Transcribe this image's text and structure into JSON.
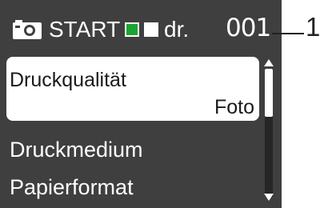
{
  "header": {
    "camera_icon": "camera-icon",
    "start_label": "START",
    "color_start_color": "#1aa531",
    "mono_start_color": "#ffffff",
    "copies_unit": "dr.",
    "copies_count": "001"
  },
  "menu": {
    "items": [
      {
        "label": "Druckqualität",
        "value": "Foto"
      },
      {
        "label": "Druckmedium"
      },
      {
        "label": "Papierformat"
      }
    ]
  },
  "scrollbar": {
    "up_icon": "scroll-up-arrow-icon",
    "down_icon": "scroll-down-arrow-icon"
  },
  "callout": {
    "number": "1"
  }
}
